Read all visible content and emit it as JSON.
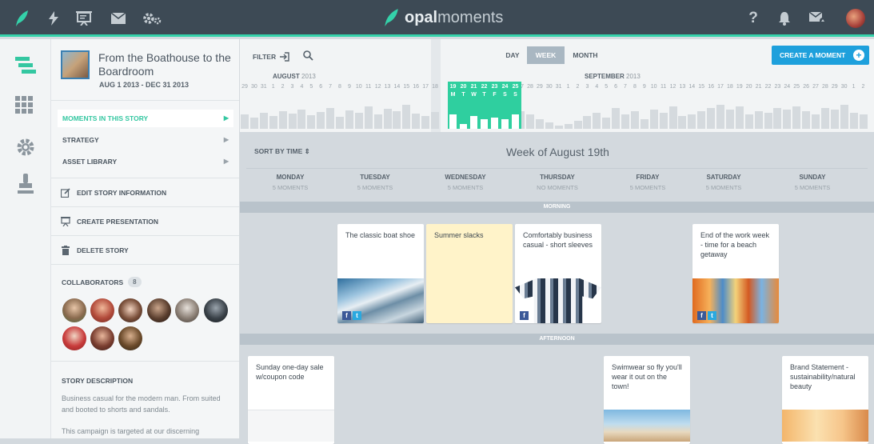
{
  "brand": {
    "name_bold": "opal",
    "name_light": "moments"
  },
  "topnav": {
    "left_icons": [
      "leaf-logo-icon",
      "lightning-icon",
      "presentation-icon",
      "mail-icon",
      "settings-icon"
    ],
    "right_icons": [
      "help-icon",
      "bell-icon",
      "messages-icon",
      "user-avatar"
    ],
    "help_glyph": "?"
  },
  "story": {
    "title": "From the Boathouse to the Boardroom",
    "dates": "AUG 1 2013 - DEC 31 2013"
  },
  "story_nav": [
    {
      "label": "MOMENTS IN THIS STORY",
      "active": true
    },
    {
      "label": "STRATEGY",
      "active": false
    },
    {
      "label": "ASSET LIBRARY",
      "active": false
    }
  ],
  "actions": {
    "edit": "EDIT STORY INFORMATION",
    "present": "CREATE PRESENTATION",
    "delete": "DELETE STORY"
  },
  "collaborators": {
    "label": "COLLABORATORS",
    "count": "8"
  },
  "description": {
    "heading": "STORY DESCRIPTION",
    "p1": "Business casual for the modern man. From suited and booted to shorts and sandals.",
    "p2": "This campaign is targeted at our discerning"
  },
  "timeline": {
    "filter_label": "FILTER",
    "view_modes": [
      "DAY",
      "WEEK",
      "MONTH"
    ],
    "selected_view": "WEEK",
    "create_button": "CREATE A MOMENT",
    "month_aug": "AUGUST",
    "month_aug_year": "2013",
    "month_sep": "SEPTEMBER",
    "month_sep_year": "2013",
    "day_numbers": [
      "29",
      "30",
      "31",
      "1",
      "2",
      "3",
      "4",
      "5",
      "6",
      "7",
      "8",
      "9",
      "10",
      "11",
      "12",
      "13",
      "14",
      "15",
      "16",
      "17",
      "18",
      "19",
      "20",
      "21",
      "22",
      "23",
      "24",
      "25",
      "26",
      "27",
      "28",
      "29",
      "30",
      "31",
      "1",
      "2",
      "3",
      "4",
      "5",
      "6",
      "7",
      "8",
      "9",
      "10",
      "11",
      "12",
      "13",
      "14",
      "15",
      "16",
      "17",
      "18",
      "19",
      "20",
      "21",
      "22",
      "23",
      "24",
      "25",
      "26",
      "27",
      "28",
      "29",
      "30",
      "1",
      "2"
    ],
    "highlight_numbers": [
      "19",
      "20",
      "21",
      "22",
      "23",
      "24",
      "25"
    ],
    "highlight_letters": [
      "M",
      "T",
      "W",
      "T",
      "F",
      "S",
      "S"
    ]
  },
  "week": {
    "sort_label": "SORT BY TIME",
    "title": "Week of August 19th",
    "days": [
      {
        "name": "MONDAY",
        "count": "5 MOMENTS"
      },
      {
        "name": "TUESDAY",
        "count": "5 MOMENTS"
      },
      {
        "name": "WEDNESDAY",
        "count": "5 MOMENTS"
      },
      {
        "name": "THURSDAY",
        "count": "NO MOMENTS"
      },
      {
        "name": "FRIDAY",
        "count": "5 MOMENTS"
      },
      {
        "name": "SATURDAY",
        "count": "5 MOMENTS"
      },
      {
        "name": "SUNDAY",
        "count": "5 MOMENTS"
      }
    ],
    "bands": {
      "morning": "MORNING",
      "afternoon": "AFTERNOON"
    }
  },
  "cards": {
    "boat_shoe": "The classic boat shoe",
    "slacks": "Summer slacks",
    "sleeves": "Comfortably business casual - short sleeves",
    "getaway": "End of the work week - time for a beach getaway",
    "sale": "Sunday one-day sale w/coupon code",
    "swimwear": "Swimwear so fly you'll wear it out on the town!",
    "brand_statement": "Brand Statement - sustainability/natural beauty"
  },
  "social": {
    "facebook": "f",
    "twitter": "t"
  }
}
